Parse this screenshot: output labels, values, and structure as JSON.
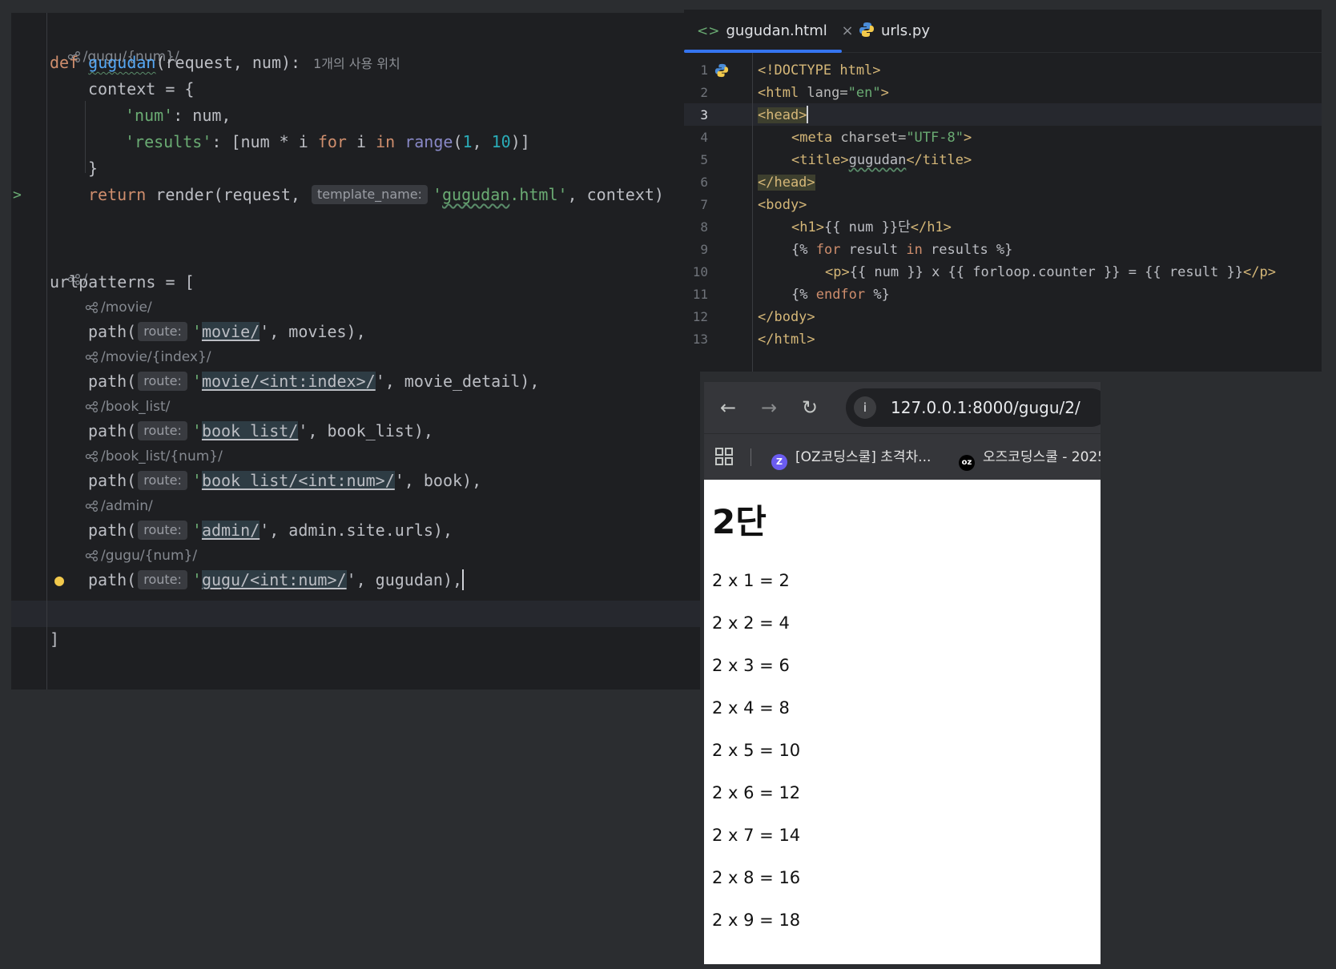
{
  "left_editor": {
    "views_route_hint": "/gugu/{num}/",
    "def_kw": "def",
    "func_name": "gugudan",
    "func_params": "(request, num):",
    "usage_hint": "1개의 사용 위치",
    "context_line": "context = {",
    "num_key": "'num'",
    "num_val": ": num,",
    "results_key": "'results'",
    "results_mid": ": [num * i ",
    "for_kw": "for",
    "i_text": " i ",
    "in_kw": "in",
    "range_fn": "range",
    "range_open": "(",
    "range_a": "1",
    "comma": ", ",
    "range_b": "10",
    "range_close": ")]",
    "close_brace": "}",
    "return_kw": "return",
    "render_call": " render(request, ",
    "template_hint": "template_name:",
    "template_str_open": "'",
    "template_name": "gugudan",
    "template_str_close": ".html'",
    "context_arg": ", context)",
    "root_route_hint": "/",
    "urlpatterns_line": "urlpatterns = [",
    "close_bracket": "]",
    "routes": [
      {
        "hint": "/movie/",
        "route": "movie/",
        "view": "', movies),"
      },
      {
        "hint": "/movie/{index}/",
        "route": "movie/<int:index>/",
        "view": "', movie_detail),"
      },
      {
        "hint": "/book_list/",
        "route": "book_list/",
        "view": "', book_list),"
      },
      {
        "hint": "/book_list/{num}/",
        "route": "book_list/<int:num>/",
        "view": "', book),"
      },
      {
        "hint": "/admin/",
        "route": "admin/",
        "view": "', admin.site.urls),"
      },
      {
        "hint": "/gugu/{num}/",
        "route": "gugu/<int:num>/",
        "view": "', gugudan),"
      }
    ],
    "path_text": "path(",
    "route_label": "route:",
    "quote": "'"
  },
  "right_editor": {
    "tabs": [
      {
        "label": "gugudan.html",
        "icon": "html-icon",
        "active": true
      },
      {
        "label": "urls.py",
        "icon": "python-icon",
        "active": false
      }
    ],
    "close_glyph": "×",
    "line_numbers": [
      "1",
      "2",
      "3",
      "4",
      "5",
      "6",
      "7",
      "8",
      "9",
      "10",
      "11",
      "12",
      "13"
    ],
    "active_line": "3",
    "code": {
      "l1": "<!DOCTYPE html>",
      "l2_tag": "<html",
      "l2_attr": " lang=",
      "l2_val": "\"en\"",
      "l2_end": ">",
      "l3": "<head>",
      "l4_tag": "<meta",
      "l4_attr": " charset=",
      "l4_val": "\"UTF-8\"",
      "l4_end": ">",
      "l5_open": "<title>",
      "l5_text": "gugudan",
      "l5_close": "</title>",
      "l6": "</head>",
      "l7": "<body>",
      "l8_open": "<h1>",
      "l8_text": "{{ num }}단",
      "l8_close": "</h1>",
      "l9_a": "{% ",
      "l9_for": "for",
      "l9_b": " result ",
      "l9_in": "in",
      "l9_c": " results %}",
      "l10_open": "<p>",
      "l10_text": "{{ num }} x {{ forloop.counter }} = {{ result }}",
      "l10_close": "</p>",
      "l11_a": "{% ",
      "l11_kw": "endfor",
      "l11_b": " %}",
      "l12": "</body>",
      "l13": "</html>"
    }
  },
  "browser": {
    "url": "127.0.0.1:8000/gugu/2/",
    "bookmarks": [
      {
        "label": "[OZ코딩스쿨] 초격차...",
        "icon_text": "Z",
        "color": "#6b5cf0"
      },
      {
        "label": "오즈코딩스쿨 - 2025",
        "icon_text": "oz",
        "color": "#000000"
      }
    ],
    "heading": "2단",
    "results": [
      "2 x 1 = 2",
      "2 x 2 = 4",
      "2 x 3 = 6",
      "2 x 4 = 8",
      "2 x 5 = 10",
      "2 x 6 = 12",
      "2 x 7 = 14",
      "2 x 8 = 16",
      "2 x 9 = 18"
    ]
  }
}
